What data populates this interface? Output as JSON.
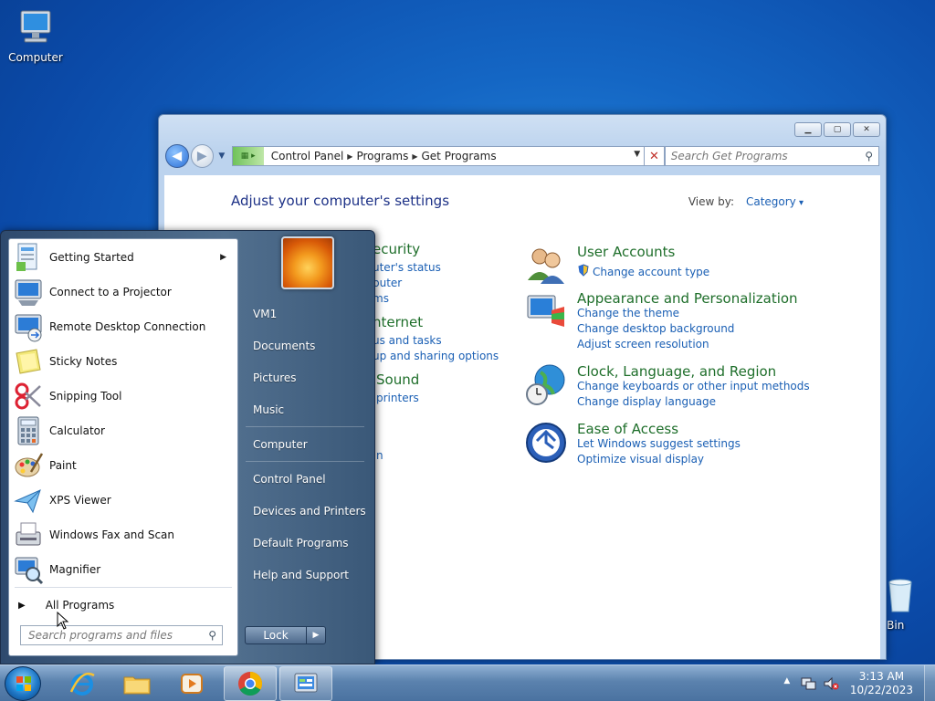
{
  "desktop": {
    "computer_label": "Computer",
    "recycle_label": "cle Bin"
  },
  "window": {
    "breadcrumbs": [
      "Control Panel",
      "Programs",
      "Get Programs"
    ],
    "search_placeholder": "Search Get Programs",
    "heading": "Adjust your computer's settings",
    "viewby_label": "View by:",
    "viewby_value": "Category",
    "left_partial": [
      {
        "title": "ecurity",
        "links": [
          "uter's status",
          "puter",
          "ms"
        ]
      },
      {
        "title": "nternet",
        "links": [
          "us and tasks",
          "up and sharing options"
        ]
      },
      {
        "title": "Sound",
        "links": [
          "printers",
          "n"
        ]
      }
    ],
    "categories": [
      {
        "title": "User Accounts",
        "links": [
          "Change account type"
        ],
        "icon": "users-icon"
      },
      {
        "title": "Appearance and Personalization",
        "links": [
          "Change the theme",
          "Change desktop background",
          "Adjust screen resolution"
        ],
        "icon": "monitor-paint-icon"
      },
      {
        "title": "Clock, Language, and Region",
        "links": [
          "Change keyboards or other input methods",
          "Change display language"
        ],
        "icon": "globe-clock-icon"
      },
      {
        "title": "Ease of Access",
        "links": [
          "Let Windows suggest settings",
          "Optimize visual display"
        ],
        "icon": "ease-of-access-icon"
      }
    ]
  },
  "start_menu": {
    "programs": [
      {
        "label": "Getting Started",
        "has_submenu": true
      },
      {
        "label": "Connect to a Projector"
      },
      {
        "label": "Remote Desktop Connection"
      },
      {
        "label": "Sticky Notes"
      },
      {
        "label": "Snipping Tool"
      },
      {
        "label": "Calculator"
      },
      {
        "label": "Paint"
      },
      {
        "label": "XPS Viewer"
      },
      {
        "label": "Windows Fax and Scan"
      },
      {
        "label": "Magnifier"
      }
    ],
    "all_programs": "All Programs",
    "search_placeholder": "Search programs and files",
    "right_items": [
      "VM1",
      "Documents",
      "Pictures",
      "Music",
      "Computer",
      "Control Panel",
      "Devices and Printers",
      "Default Programs",
      "Help and Support"
    ],
    "lock_label": "Lock"
  },
  "taskbar": {
    "time": "3:13 AM",
    "date": "10/22/2023",
    "pinned": [
      "internet-explorer-icon",
      "file-explorer-icon",
      "media-player-icon",
      "chrome-icon",
      "control-panel-icon"
    ]
  }
}
